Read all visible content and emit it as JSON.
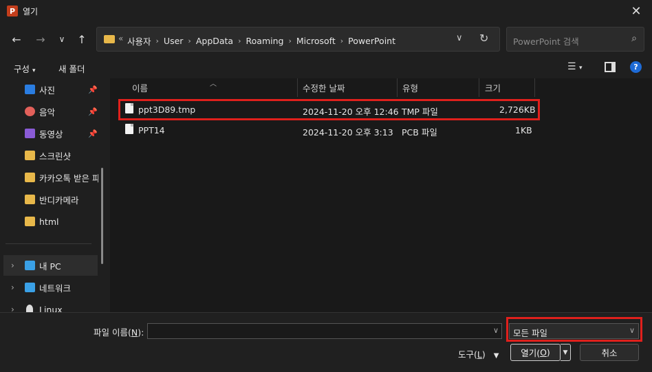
{
  "window": {
    "title": "열기",
    "close": "✕"
  },
  "nav": {
    "breadcrumb": [
      "사용자",
      "User",
      "AppData",
      "Roaming",
      "Microsoft",
      "PowerPoint"
    ],
    "search_placeholder": "PowerPoint 검색"
  },
  "toolbar": {
    "organize": "구성",
    "new_folder": "새 폴더"
  },
  "sidebar": {
    "items": [
      {
        "label": "사진",
        "icon": "photos-icon",
        "pinned": true
      },
      {
        "label": "음악",
        "icon": "music-icon",
        "pinned": true
      },
      {
        "label": "동영상",
        "icon": "video-icon",
        "pinned": true
      },
      {
        "label": "스크린샷",
        "icon": "folder-icon",
        "pinned": false
      },
      {
        "label": "카카오톡 받은 파일",
        "icon": "folder-icon",
        "pinned": false
      },
      {
        "label": "반디카메라",
        "icon": "folder-icon",
        "pinned": false
      },
      {
        "label": "html",
        "icon": "folder-icon",
        "pinned": false
      },
      {
        "label": "내 PC",
        "icon": "pc-icon",
        "pinned": false
      },
      {
        "label": "네트워크",
        "icon": "network-icon",
        "pinned": false
      },
      {
        "label": "Linux",
        "icon": "linux-icon",
        "pinned": false
      }
    ]
  },
  "columns": {
    "name": "이름",
    "modified": "수정한 날짜",
    "type": "유형",
    "size": "크기"
  },
  "files": [
    {
      "name": "ppt3D89.tmp",
      "modified": "2024-11-20 오후 12:46",
      "type": "TMP 파일",
      "size": "2,726KB"
    },
    {
      "name": "PPT14",
      "modified": "2024-11-20 오후 3:13",
      "type": "PCB 파일",
      "size": "1KB"
    }
  ],
  "bottom": {
    "filename_label": "파일 이름(",
    "filename_key": "N",
    "filename_label_end": "):",
    "filename_value": "",
    "filetype": "모든 파일",
    "tools_label": "도구(",
    "tools_key": "L",
    "tools_label_end": ")",
    "open_label": "열기(",
    "open_key": "O",
    "open_label_end": ")",
    "cancel": "취소"
  },
  "colors": {
    "highlight": "#e0201c",
    "accent": "#1e6bd6",
    "folder": "#e8b84a"
  }
}
